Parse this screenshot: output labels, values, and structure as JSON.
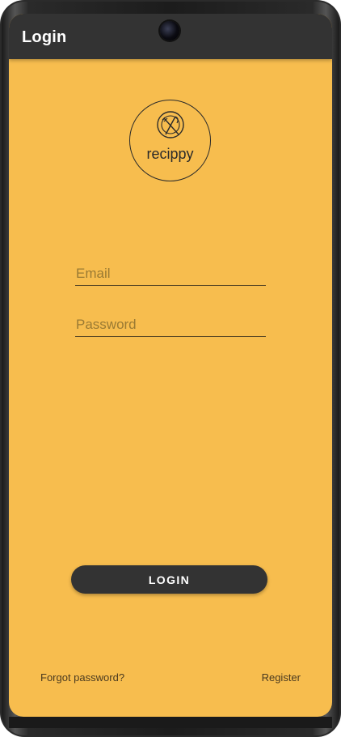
{
  "app_bar": {
    "title": "Login"
  },
  "logo": {
    "icon": "plate-fork-knife-icon",
    "text": "recippy"
  },
  "form": {
    "email_placeholder": "Email",
    "email_value": "",
    "password_placeholder": "Password",
    "password_value": ""
  },
  "actions": {
    "login_label": "LOGIN",
    "forgot_label": "Forgot password?",
    "register_label": "Register"
  },
  "colors": {
    "background": "#f7bd4e",
    "app_bar": "#333333",
    "button": "#333333",
    "button_text": "#ffffff"
  }
}
